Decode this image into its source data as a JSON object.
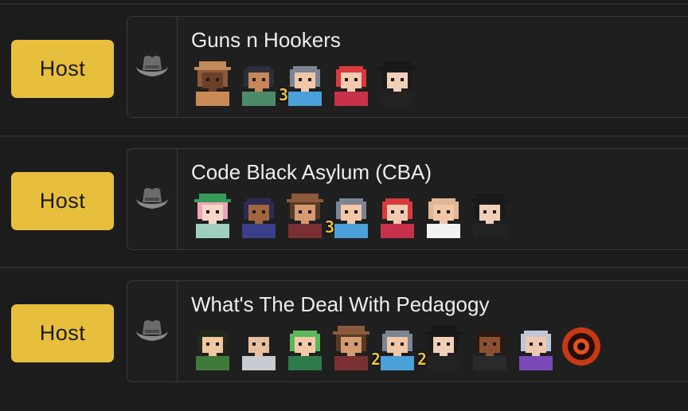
{
  "colors": {
    "background": "#1c1c1d",
    "card_border": "#3a3a3c",
    "host_button": "#e8bf3c",
    "title_text": "#ededed",
    "badge_text": "#e8c23a"
  },
  "rows": [
    {
      "host_label": "Host",
      "hat_icon": "cowboy-hat-icon",
      "title": "Guns n Hookers",
      "avatars": [
        {
          "icon": "sheriff-avatar"
        },
        {
          "icon": "adventurer-avatar"
        },
        {
          "icon": "gray-hair-avatar",
          "badge": "3"
        },
        {
          "icon": "red-hair-woman-avatar"
        },
        {
          "icon": "mafioso-avatar"
        }
      ]
    },
    {
      "host_label": "Host",
      "hat_icon": "cowboy-hat-icon",
      "title": "Code Black Asylum (CBA)",
      "avatars": [
        {
          "icon": "elf-nurse-avatar"
        },
        {
          "icon": "dark-hair-woman-avatar"
        },
        {
          "icon": "cowboy-avatar"
        },
        {
          "icon": "gray-hair-avatar",
          "badge": "3"
        },
        {
          "icon": "red-hair-woman-avatar"
        },
        {
          "icon": "bald-man-avatar"
        },
        {
          "icon": "mafioso-avatar"
        }
      ]
    },
    {
      "host_label": "Host",
      "hat_icon": "cowboy-hat-icon",
      "title": "What's The Deal With Pedagogy",
      "avatars": [
        {
          "icon": "green-coat-avatar"
        },
        {
          "icon": "glasses-avatar"
        },
        {
          "icon": "green-hair-avatar"
        },
        {
          "icon": "cowboy-avatar"
        },
        {
          "icon": "gray-hair-avatar",
          "badge": "2"
        },
        {
          "icon": "mafioso-avatar",
          "badge": "2"
        },
        {
          "icon": "curly-hair-woman-avatar"
        },
        {
          "icon": "old-wizard-avatar"
        },
        {
          "icon": "dark-orb-avatar"
        }
      ]
    }
  ]
}
